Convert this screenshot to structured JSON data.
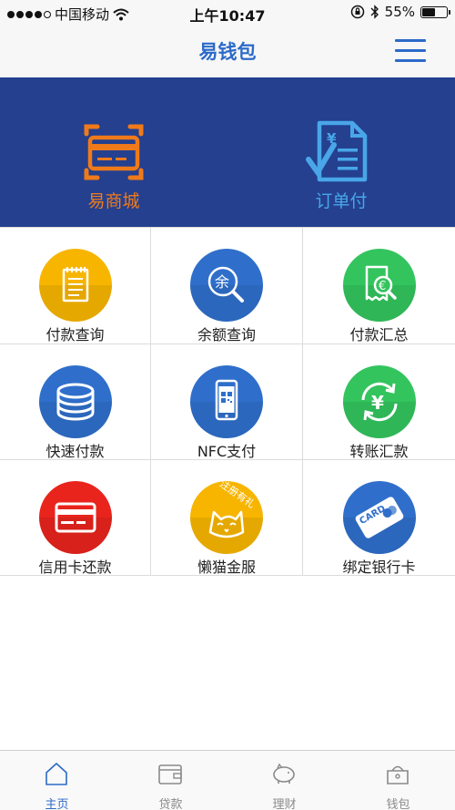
{
  "status_bar": {
    "carrier": "中国移动",
    "time": "上午10:47",
    "battery": "55%",
    "battery_level": 0.55
  },
  "nav": {
    "title": "易钱包",
    "menu_icon": "hamburger-icon"
  },
  "banner": {
    "items": [
      {
        "label": "易商城",
        "icon": "card-frame-icon",
        "color": "#f07a1a"
      },
      {
        "label": "订单付",
        "icon": "yuan-document-icon",
        "color": "#49a6e8"
      }
    ]
  },
  "grid": {
    "items": [
      {
        "label": "付款查询",
        "icon": "notepad-icon",
        "color": "#f7b500"
      },
      {
        "label": "余额查询",
        "icon": "balance-search-icon",
        "color": "#2f6fcb"
      },
      {
        "label": "付款汇总",
        "icon": "receipt-euro-icon",
        "color": "#33c45e"
      },
      {
        "label": "快速付款",
        "icon": "coin-stack-icon",
        "color": "#2f6fcb"
      },
      {
        "label": "NFC支付",
        "icon": "phone-qr-icon",
        "color": "#2f6fcb"
      },
      {
        "label": "转账汇款",
        "icon": "yuan-transfer-icon",
        "color": "#33c45e"
      },
      {
        "label": "信用卡还款",
        "icon": "credit-card-icon",
        "color": "#e8241c"
      },
      {
        "label": "懒猫金服",
        "icon": "cat-face-icon",
        "color": "#f7b500",
        "badge": "注册有礼"
      },
      {
        "label": "绑定银行卡",
        "icon": "bank-card-icon",
        "color": "#2f6fcb",
        "card_text": "CARD"
      }
    ]
  },
  "tab_bar": {
    "items": [
      {
        "label": "主页",
        "icon": "home-icon",
        "active": true
      },
      {
        "label": "贷款",
        "icon": "wallet-icon",
        "active": false
      },
      {
        "label": "理财",
        "icon": "piggy-bank-icon",
        "active": false
      },
      {
        "label": "钱包",
        "icon": "purse-icon",
        "active": false
      }
    ],
    "active_color": "#2c6ac9"
  },
  "colors": {
    "brand_blue": "#2c6ac9",
    "banner_bg": "#24408f"
  }
}
